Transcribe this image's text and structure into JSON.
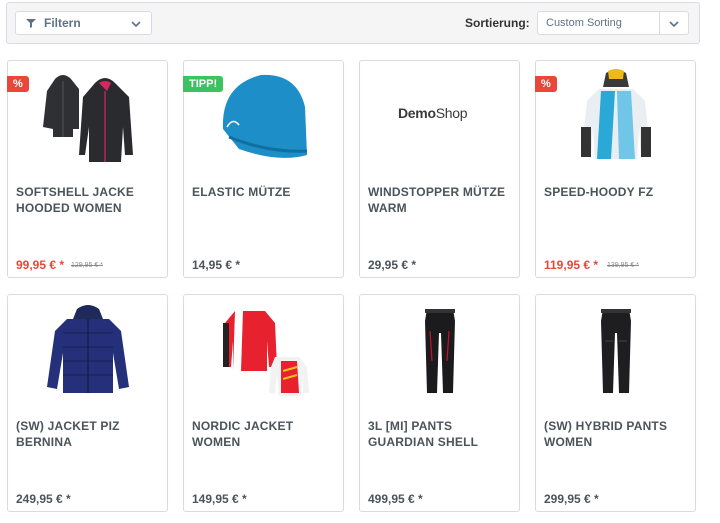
{
  "toolbar": {
    "filter_label": "Filtern",
    "sort_label": "Sortierung:",
    "sort_value": "Custom Sorting"
  },
  "colors": {
    "sale": "#e8473a",
    "tip_badge": "#3cc261",
    "text": "#4a545b",
    "border": "#dadae5"
  },
  "products": [
    {
      "name": "SOFTSHELL JACKE HOODED WOMEN",
      "price": "99,95 € *",
      "old_price": "129,95 € *",
      "badge": "%",
      "image": "softshell-jackets-image"
    },
    {
      "name": "ELASTIC MÜTZE",
      "price": "14,95 € *",
      "badge": "TIPP!",
      "image": "blue-beanie-image"
    },
    {
      "name": "WINDSTOPPER MÜTZE WARM",
      "price": "29,95 € *",
      "logo": "DemoShop",
      "image": "demoshop-placeholder-image"
    },
    {
      "name": "SPEED-HOODY FZ",
      "price": "119,95 € *",
      "old_price": "139,95 € *",
      "badge": "%",
      "image": "speed-hoody-image"
    },
    {
      "name": "(SW) JACKET PIZ BERNINA",
      "price": "249,95 € *",
      "image": "navy-jacket-image"
    },
    {
      "name": "NORDIC JACKET WOMEN",
      "price": "149,95 € *",
      "image": "nordic-jacket-image"
    },
    {
      "name": "3L [MI] PANTS GUARDIAN SHELL",
      "price": "499,95 € *",
      "image": "black-pants-image"
    },
    {
      "name": "(SW) HYBRID PANTS WOMEN",
      "price": "299,95 € *",
      "image": "hybrid-pants-image"
    }
  ]
}
